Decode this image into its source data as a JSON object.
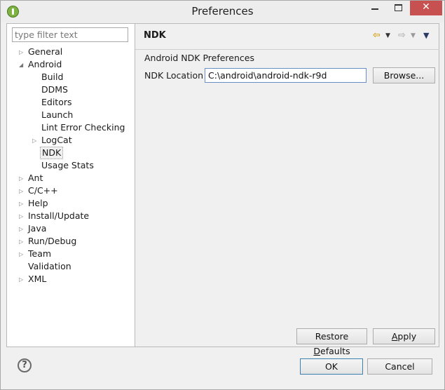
{
  "window": {
    "title": "Preferences",
    "close_glyph": "✕"
  },
  "filter": {
    "placeholder": "type filter text"
  },
  "tree": [
    {
      "label": "General",
      "expandable": true
    },
    {
      "label": "Android",
      "expandable": true,
      "expanded": true
    },
    {
      "label": "Build"
    },
    {
      "label": "DDMS"
    },
    {
      "label": "Editors"
    },
    {
      "label": "Launch"
    },
    {
      "label": "Lint Error Checking"
    },
    {
      "label": "LogCat",
      "expandable": true
    },
    {
      "label": "NDK",
      "selected": true
    },
    {
      "label": "Usage Stats"
    },
    {
      "label": "Ant",
      "expandable": true
    },
    {
      "label": "C/C++",
      "expandable": true
    },
    {
      "label": "Help",
      "expandable": true
    },
    {
      "label": "Install/Update",
      "expandable": true
    },
    {
      "label": "Java",
      "expandable": true
    },
    {
      "label": "Run/Debug",
      "expandable": true
    },
    {
      "label": "Team",
      "expandable": true
    },
    {
      "label": "Validation"
    },
    {
      "label": "XML",
      "expandable": true
    }
  ],
  "page": {
    "title": "NDK",
    "group_title": "Android NDK Preferences",
    "ndk_location_label": "NDK Location",
    "ndk_location_value": "C:\\android\\android-ndk-r9d",
    "browse_label": "Browse..."
  },
  "icons": {
    "back": "⇦",
    "forward": "⇨",
    "dropdown": "▼",
    "help": "?"
  },
  "buttons": {
    "restore_prefix": "Restore ",
    "restore_mnemonic": "D",
    "restore_suffix": "efaults",
    "apply_mnemonic": "A",
    "apply_suffix": "pply",
    "ok": "OK",
    "cancel": "Cancel"
  }
}
